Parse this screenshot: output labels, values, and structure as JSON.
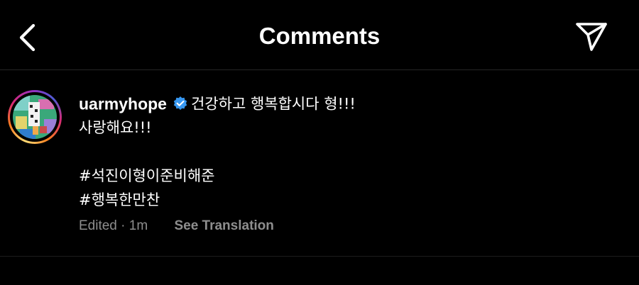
{
  "header": {
    "title": "Comments",
    "back_icon": "chevron-left-icon",
    "share_icon": "paper-plane-icon"
  },
  "comment": {
    "username": "uarmyhope",
    "verified": true,
    "text_line1": "건강하고 행복합시다 형!!!",
    "text_line2": "사랑해요!!!",
    "hashtags": [
      "#석진이형이준비해준",
      "#행복한만찬"
    ],
    "status": "Edited",
    "separator": "·",
    "time": "1m",
    "translate_label": "See Translation"
  },
  "colors": {
    "background": "#000000",
    "text": "#ffffff",
    "secondary_text": "#8e8e8e",
    "verified_badge": "#3797f0",
    "divider": "#262626"
  }
}
